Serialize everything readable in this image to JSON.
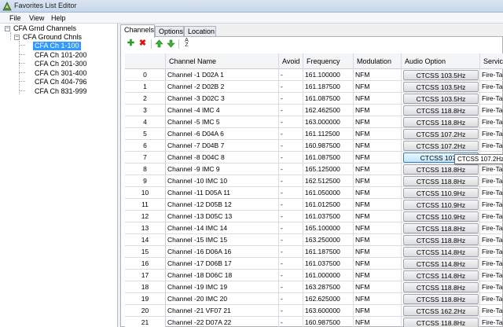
{
  "window": {
    "title": "Favorites List Editor",
    "icon": "radio-app-icon"
  },
  "menu": [
    "File",
    "View",
    "Help"
  ],
  "tree": {
    "root": "CFA Grnd Channels",
    "group": "CFA Ground Chnls",
    "items": [
      "CFA Ch 1-100",
      "CFA Ch 101-200",
      "CFA Ch 201-300",
      "CFA Ch 301-400",
      "CFA Ch 404-796",
      "CFA Ch 831-999"
    ],
    "selected_index": 0
  },
  "tabs": [
    {
      "label": "Channels",
      "active": true
    },
    {
      "label": "Options",
      "active": false
    },
    {
      "label": "Location",
      "active": false
    }
  ],
  "toolbar": {
    "icons": [
      "add-icon",
      "delete-icon",
      "move-up-icon",
      "move-down-icon",
      "sort-icon"
    ],
    "sort_glyph": "AZ"
  },
  "grid": {
    "columns": [
      "Channel Name",
      "Avoid",
      "Frequency",
      "Modulation",
      "Audio Option",
      "Service"
    ],
    "rows": [
      {
        "idx": "0",
        "name": "Channel -1 D02A 1",
        "avoid": "-",
        "freq": "161.100000",
        "mod": "NFM",
        "audio": "CTCSS 103.5Hz",
        "service": "Fire-Talk"
      },
      {
        "idx": "1",
        "name": "Channel -2 D02B 2",
        "avoid": "-",
        "freq": "161.187500",
        "mod": "NFM",
        "audio": "CTCSS 103.5Hz",
        "service": "Fire-Talk"
      },
      {
        "idx": "2",
        "name": "Channel -3 D02C 3",
        "avoid": "-",
        "freq": "161.087500",
        "mod": "NFM",
        "audio": "CTCSS 103.5Hz",
        "service": "Fire-Talk"
      },
      {
        "idx": "3",
        "name": "Channel -4 IMC 4",
        "avoid": "-",
        "freq": "162.462500",
        "mod": "NFM",
        "audio": "CTCSS 118.8Hz",
        "service": "Fire-Talk"
      },
      {
        "idx": "4",
        "name": "Channel -5 IMC 5",
        "avoid": "-",
        "freq": "163.000000",
        "mod": "NFM",
        "audio": "CTCSS 118.8Hz",
        "service": "Fire-Talk"
      },
      {
        "idx": "5",
        "name": "Channel -6 D04A 6",
        "avoid": "-",
        "freq": "161.112500",
        "mod": "NFM",
        "audio": "CTCSS 107.2Hz",
        "service": "Fire-Talk"
      },
      {
        "idx": "6",
        "name": "Channel -7 D04B 7",
        "avoid": "-",
        "freq": "160.987500",
        "mod": "NFM",
        "audio": "CTCSS 107.2Hz",
        "service": "Fire-Talk"
      },
      {
        "idx": "7",
        "name": "Channel -8 D04C 8",
        "avoid": "-",
        "freq": "161.087500",
        "mod": "NFM",
        "audio": "CTCSS 107.2",
        "service": "Fire-Talk"
      },
      {
        "idx": "8",
        "name": "Channel -9 IMC 9",
        "avoid": "-",
        "freq": "165.125000",
        "mod": "NFM",
        "audio": "CTCSS 118.8Hz",
        "service": "Fire-Talk"
      },
      {
        "idx": "9",
        "name": "Channel -10 IMC 10",
        "avoid": "-",
        "freq": "162.512500",
        "mod": "NFM",
        "audio": "CTCSS 118.8Hz",
        "service": "Fire-Talk"
      },
      {
        "idx": "10",
        "name": "Channel -11 D05A 11",
        "avoid": "-",
        "freq": "161.050000",
        "mod": "NFM",
        "audio": "CTCSS 110.9Hz",
        "service": "Fire-Talk"
      },
      {
        "idx": "11",
        "name": "Channel -12 D05B 12",
        "avoid": "-",
        "freq": "161.012500",
        "mod": "NFM",
        "audio": "CTCSS 110.9Hz",
        "service": "Fire-Talk"
      },
      {
        "idx": "12",
        "name": "Channel -13 D05C 13",
        "avoid": "-",
        "freq": "161.037500",
        "mod": "NFM",
        "audio": "CTCSS 110.9Hz",
        "service": "Fire-Talk"
      },
      {
        "idx": "13",
        "name": "Channel -14 IMC 14",
        "avoid": "-",
        "freq": "165.100000",
        "mod": "NFM",
        "audio": "CTCSS 118.8Hz",
        "service": "Fire-Talk"
      },
      {
        "idx": "14",
        "name": "Channel -15 IMC 15",
        "avoid": "-",
        "freq": "163.250000",
        "mod": "NFM",
        "audio": "CTCSS 118.8Hz",
        "service": "Fire-Talk"
      },
      {
        "idx": "15",
        "name": "Channel -16 D06A 16",
        "avoid": "-",
        "freq": "161.187500",
        "mod": "NFM",
        "audio": "CTCSS 114.8Hz",
        "service": "Fire-Talk"
      },
      {
        "idx": "16",
        "name": "Channel -17 D06B 17",
        "avoid": "-",
        "freq": "161.037500",
        "mod": "NFM",
        "audio": "CTCSS 114.8Hz",
        "service": "Fire-Talk"
      },
      {
        "idx": "17",
        "name": "Channel -18 D06C 18",
        "avoid": "-",
        "freq": "161.000000",
        "mod": "NFM",
        "audio": "CTCSS 114.8Hz",
        "service": "Fire-Talk"
      },
      {
        "idx": "18",
        "name": "Channel -19 IMC 19",
        "avoid": "-",
        "freq": "163.287500",
        "mod": "NFM",
        "audio": "CTCSS 118.8Hz",
        "service": "Fire-Talk"
      },
      {
        "idx": "19",
        "name": "Channel -20 IMC 20",
        "avoid": "-",
        "freq": "162.625000",
        "mod": "NFM",
        "audio": "CTCSS 118.8Hz",
        "service": "Fire-Talk"
      },
      {
        "idx": "20",
        "name": "Channel -21 VF07 21",
        "avoid": "-",
        "freq": "163.600000",
        "mod": "NFM",
        "audio": "CTCSS 162.2Hz",
        "service": "Fire-Talk"
      },
      {
        "idx": "21",
        "name": "Channel -22 D07A 22",
        "avoid": "-",
        "freq": "160.987500",
        "mod": "NFM",
        "audio": "CTCSS 118.8Hz",
        "service": "Fire-Talk"
      }
    ],
    "hover_row_index": 7
  },
  "tooltip": {
    "text": "CTCSS 107.2Hz"
  }
}
